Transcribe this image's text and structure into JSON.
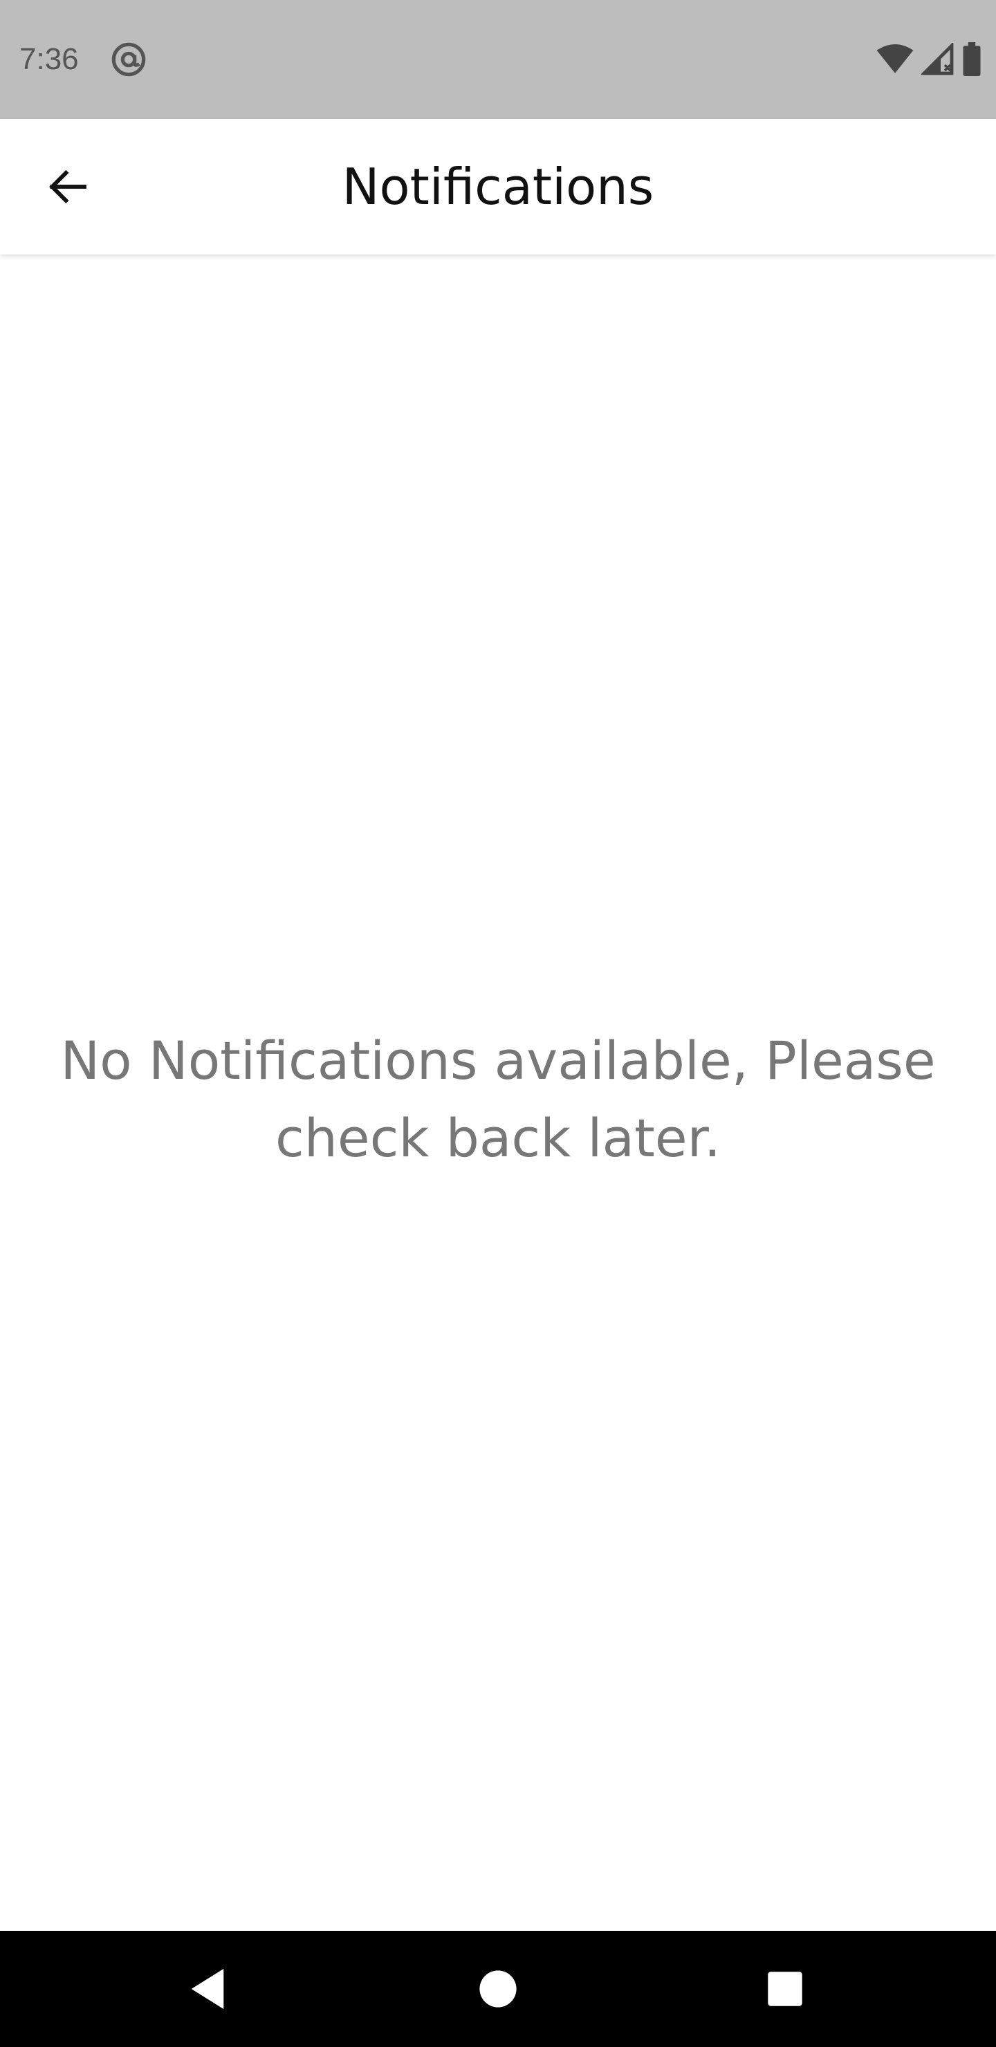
{
  "status_bar": {
    "time": "7:36",
    "icons": [
      "at-sign-icon",
      "wifi-icon",
      "cell-signal-icon",
      "battery-icon"
    ]
  },
  "app_bar": {
    "title": "Notifications",
    "back_icon": "back-arrow-icon"
  },
  "content": {
    "empty_message": "No Notifications available, Please check back later."
  },
  "nav_bar": {
    "buttons": [
      "back-triangle-icon",
      "home-circle-icon",
      "recents-square-icon"
    ]
  },
  "colors": {
    "status_bar_bg": "#bdbdbd",
    "app_bar_bg": "#ffffff",
    "title_text": "#111111",
    "empty_text": "#777777",
    "nav_bar_bg": "#000000"
  }
}
